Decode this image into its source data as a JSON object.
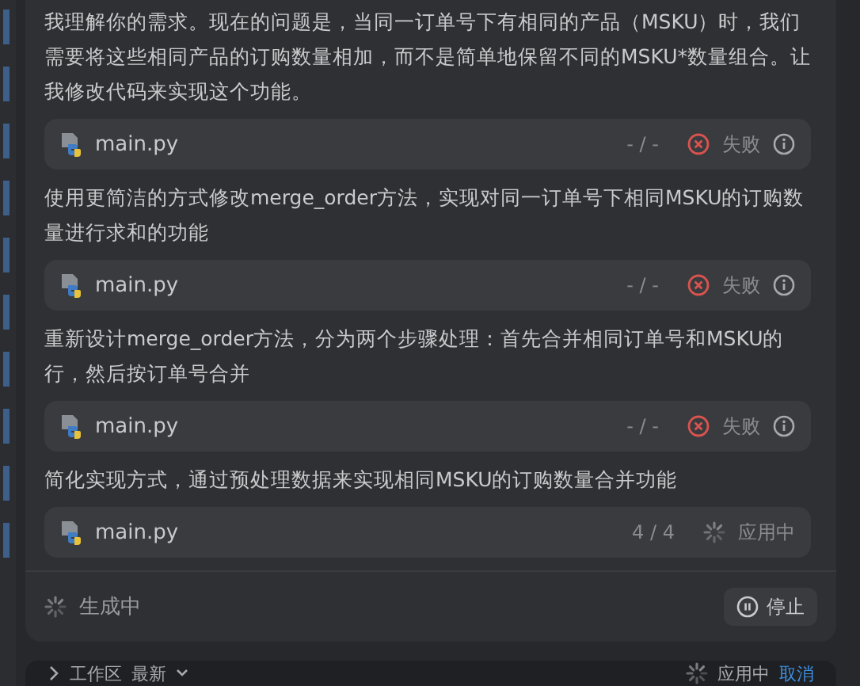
{
  "messages": [
    {
      "kind": "text",
      "text": "我理解你的需求。现在的问题是，当同一订单号下有相同的产品（MSKU）时，我们需要将这些相同产品的订购数量相加，而不是简单地保留不同的MSKU*数量组合。让我修改代码来实现这个功能。"
    },
    {
      "kind": "file",
      "name": "main.py",
      "progress": "- / -",
      "failed": true,
      "status_label": "失败"
    },
    {
      "kind": "text",
      "text": "使用更简洁的方式修改merge_order方法，实现对同一订单号下相同MSKU的订购数量进行求和的功能"
    },
    {
      "kind": "file",
      "name": "main.py",
      "progress": "- / -",
      "failed": true,
      "status_label": "失败"
    },
    {
      "kind": "text",
      "text": "重新设计merge_order方法，分为两个步骤处理：首先合并相同订单号和MSKU的行，然后按订单号合并"
    },
    {
      "kind": "file",
      "name": "main.py",
      "progress": "- / -",
      "failed": true,
      "status_label": "失败"
    },
    {
      "kind": "text",
      "text": "简化实现方式，通过预处理数据来实现相同MSKU的订购数量合并功能"
    },
    {
      "kind": "file",
      "name": "main.py",
      "progress": "4 / 4",
      "failed": false,
      "status_label": "应用中"
    }
  ],
  "generating": {
    "label": "生成中",
    "stop_button": "停止"
  },
  "workspace_bar": {
    "title": "工作区",
    "version": "最新",
    "status": "应用中",
    "cancel": "取消"
  }
}
